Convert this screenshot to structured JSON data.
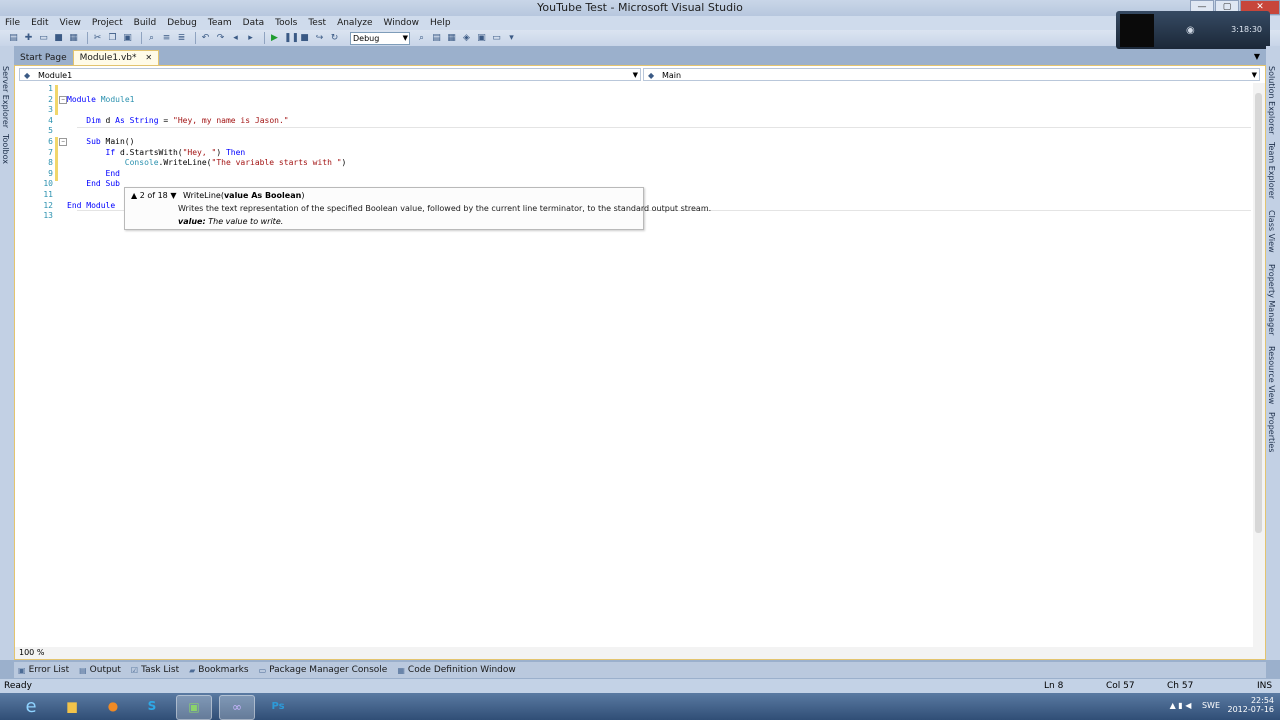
{
  "window": {
    "title": "YouTube Test - Microsoft Visual Studio",
    "controls": {
      "minimize": "—",
      "maximize": "▢",
      "close": "✕"
    }
  },
  "menu": [
    "File",
    "Edit",
    "View",
    "Project",
    "Build",
    "Debug",
    "Team",
    "Data",
    "Tools",
    "Test",
    "Analyze",
    "Window",
    "Help"
  ],
  "toolbar": {
    "configuration": "Debug"
  },
  "recording": {
    "timer": "3:18:30"
  },
  "left_sidebar": {
    "items": [
      "Server Explorer",
      "Toolbox"
    ]
  },
  "right_sidebar": {
    "items": [
      "Solution Explorer",
      "Team Explorer",
      "Class View",
      "Property Manager",
      "Resource View",
      "Properties"
    ]
  },
  "tabs": [
    {
      "label": "Start Page",
      "active": false
    },
    {
      "label": "Module1.vb*",
      "active": true
    }
  ],
  "nav": {
    "left": "Module1",
    "right": "Main"
  },
  "code_lines": [
    {
      "n": "1",
      "text": ""
    },
    {
      "n": "2",
      "text": "Module Module1"
    },
    {
      "n": "3",
      "text": ""
    },
    {
      "n": "4",
      "text": "    Dim d As String = \"Hey, my name is Jason.\""
    },
    {
      "n": "5",
      "text": ""
    },
    {
      "n": "6",
      "text": "    Sub Main()"
    },
    {
      "n": "7",
      "text": "        If d.StartsWith(\"Hey, \") Then"
    },
    {
      "n": "8",
      "text": "            Console.WriteLine(\"The variable starts with \")"
    },
    {
      "n": "9",
      "text": "        End"
    },
    {
      "n": "10",
      "text": "    End Sub"
    },
    {
      "n": "11",
      "text": ""
    },
    {
      "n": "12",
      "text": "End Module"
    },
    {
      "n": "13",
      "text": ""
    }
  ],
  "tooltip": {
    "overload": "2 of 18",
    "signature_name": "WriteLine(",
    "signature_param": "value As Boolean",
    "signature_end": ")",
    "description": "Writes the text representation of the specified Boolean value, followed by the current line terminator, to the standard output stream.",
    "param_name": "value:",
    "param_desc": "The value to write."
  },
  "editor": {
    "zoom": "100 %"
  },
  "bottom_tabs": [
    "Error List",
    "Output",
    "Task List",
    "Bookmarks",
    "Package Manager Console",
    "Code Definition Window"
  ],
  "status": {
    "state": "Ready",
    "line": "Ln 8",
    "col": "Col 57",
    "ch": "Ch 57",
    "mode": "INS"
  },
  "taskbar": {
    "apps": [
      "internet-explorer",
      "file-explorer",
      "firefox",
      "skype",
      "visual-studio-launcher",
      "visual-studio",
      "photoshop"
    ],
    "language": "SWE",
    "time": "22:54",
    "date": "2012-07-16"
  }
}
